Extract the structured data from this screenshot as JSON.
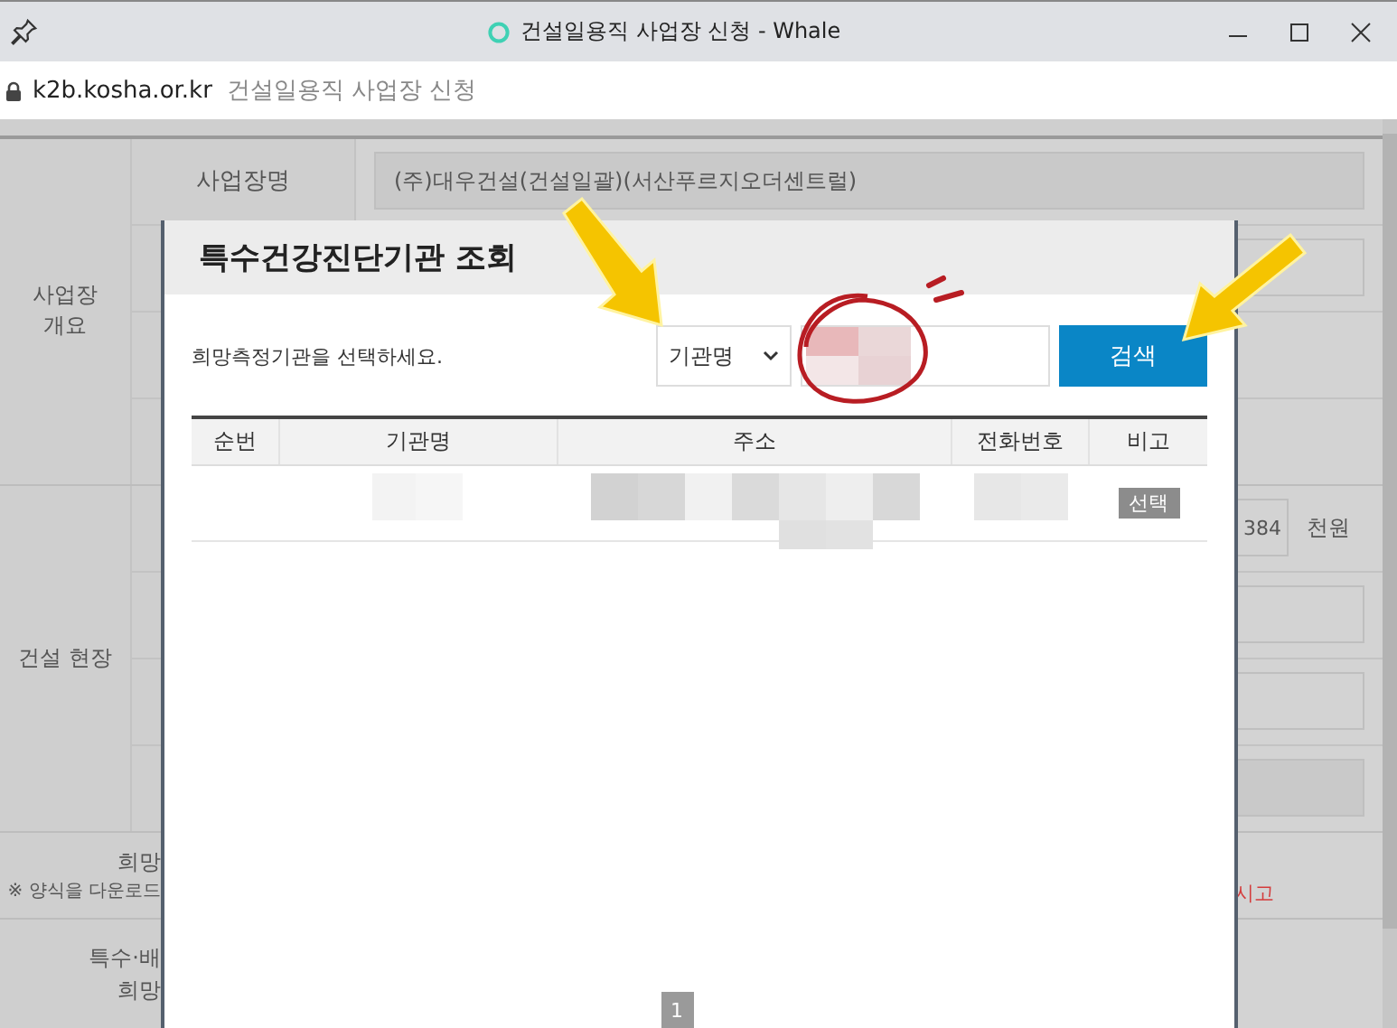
{
  "window": {
    "title": "건설일용직 사업장 신청 - Whale"
  },
  "address_bar": {
    "domain": "k2b.kosha.or.kr",
    "page_title": "건설일용직 사업장 신청"
  },
  "form": {
    "sections": [
      {
        "label": "사업장 개요",
        "rows": [
          {
            "kind": "readonly",
            "label": "사업장명",
            "value": "(주)대우건설(건설일괄)(서산푸르지오더센트럴)"
          },
          {
            "kind": "input"
          },
          {
            "kind": "blank"
          },
          {
            "kind": "blank"
          }
        ]
      },
      {
        "label": "건설 현장",
        "rows": [
          {
            "kind": "amount",
            "value": "384",
            "unit": "천원"
          },
          {
            "kind": "input"
          },
          {
            "kind": "input"
          },
          {
            "kind": "readonly"
          }
        ]
      }
    ],
    "notes": [
      {
        "lines": [
          {
            "kind": "title",
            "text": "희망"
          },
          {
            "kind": "note",
            "text": "※ 양식을 다운로드"
          }
        ],
        "warning": "시고"
      },
      {
        "lines": [
          {
            "kind": "title",
            "text": "특수·배"
          },
          {
            "kind": "title",
            "text": "희망"
          }
        ]
      }
    ]
  },
  "modal": {
    "title": "특수건강진단기관 조회",
    "instruction": "희망측정기관을 선택하세요.",
    "search_type": "기관명",
    "search_button": "검색",
    "table": {
      "columns": [
        "순번",
        "기관명",
        "주소",
        "전화번호",
        "비고"
      ],
      "rows": [
        {
          "action": "선택"
        }
      ]
    },
    "pagination": [
      {
        "label": "1",
        "selected": true
      }
    ]
  }
}
